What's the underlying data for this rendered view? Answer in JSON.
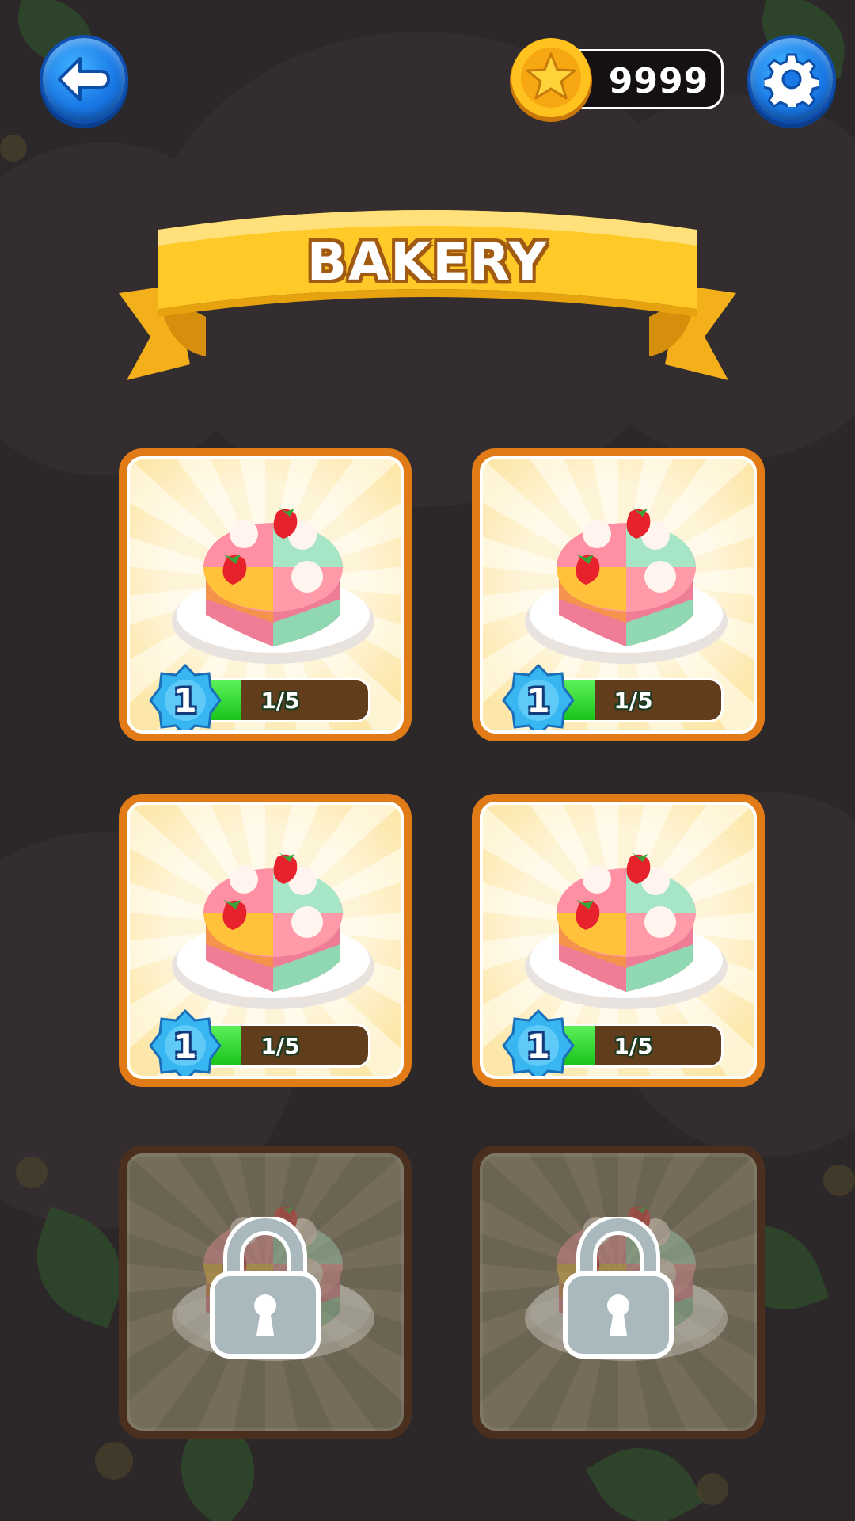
{
  "header": {
    "coins": "9999",
    "back_icon": "back-arrow-icon",
    "settings_icon": "gear-icon",
    "coin_icon": "star-coin-icon"
  },
  "title": "BAKERY",
  "colors": {
    "background": "#2c2728",
    "button_blue": "#1a79e6",
    "banner_yellow": "#ffc928",
    "card_border": "#e07b18",
    "progress_green": "#18c41a",
    "level_badge": "#37b6f2"
  },
  "levels": [
    {
      "level": "1",
      "progress_text": "1/5",
      "progress": 0.2,
      "locked": false
    },
    {
      "level": "1",
      "progress_text": "1/5",
      "progress": 0.2,
      "locked": false
    },
    {
      "level": "1",
      "progress_text": "1/5",
      "progress": 0.2,
      "locked": false
    },
    {
      "level": "1",
      "progress_text": "1/5",
      "progress": 0.2,
      "locked": false
    },
    {
      "locked": true,
      "icon": "padlock-icon"
    },
    {
      "locked": true,
      "icon": "padlock-icon"
    }
  ]
}
